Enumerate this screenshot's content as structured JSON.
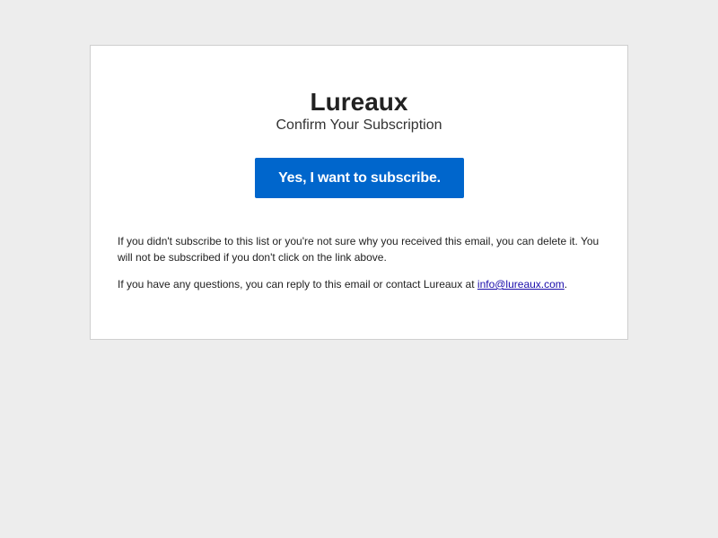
{
  "email": {
    "brand_name": "Lureaux",
    "subtitle": "Confirm Your Subscription",
    "confirm_button_label": "Yes, I want to subscribe.",
    "paragraph_1": "If you didn't subscribe to this list or you're not sure why you received this email, you can delete it. You will not be subscribed if you don't click on the link above.",
    "paragraph_2_prefix": "If you have any questions, you can reply to this email or contact Lureaux at ",
    "contact_email": "info@lureaux.com",
    "paragraph_2_suffix": "."
  },
  "colors": {
    "page_background": "#ededed",
    "card_background": "#ffffff",
    "button_background": "#0066cc",
    "link_color": "#1a0dab"
  }
}
